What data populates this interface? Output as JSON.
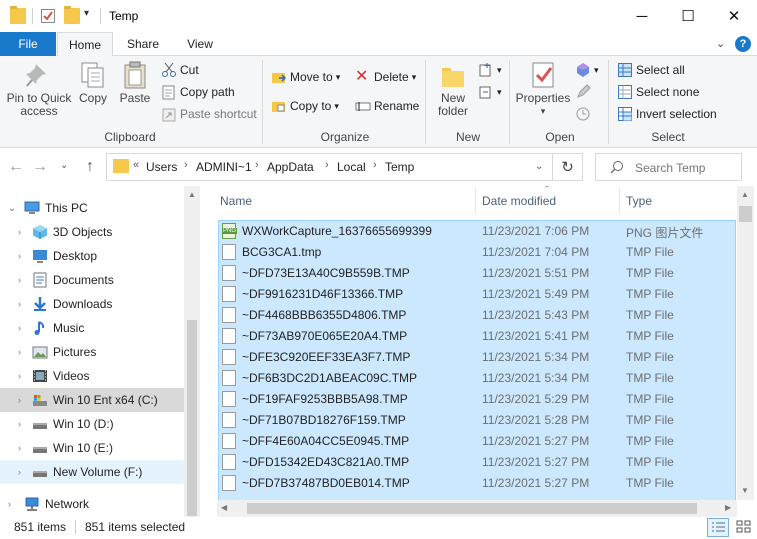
{
  "window": {
    "title": "Temp",
    "minimize_glyph": "─",
    "maximize_glyph": "☐",
    "close_glyph": "✕"
  },
  "ribbon_tabs": {
    "file": "File",
    "home": "Home",
    "share": "Share",
    "view": "View"
  },
  "ribbon": {
    "clipboard": {
      "label": "Clipboard",
      "pin": "Pin to Quick access",
      "copy": "Copy",
      "paste": "Paste",
      "cut": "Cut",
      "copy_path": "Copy path",
      "paste_shortcut": "Paste shortcut"
    },
    "organize": {
      "label": "Organize",
      "move_to": "Move to",
      "copy_to": "Copy to",
      "delete": "Delete",
      "rename": "Rename"
    },
    "new": {
      "label": "New",
      "new_folder": "New folder"
    },
    "open": {
      "label": "Open",
      "properties": "Properties"
    },
    "select": {
      "label": "Select",
      "select_all": "Select all",
      "select_none": "Select none",
      "invert_selection": "Invert selection"
    }
  },
  "address": {
    "overflow": "«",
    "crumbs": [
      "Users",
      "ADMINI~1",
      "AppData",
      "Local",
      "Temp"
    ],
    "search_placeholder": "Search Temp"
  },
  "nav_pane": {
    "items": [
      {
        "label": "This PC",
        "icon": "computer-icon"
      },
      {
        "label": "3D Objects",
        "icon": "cube-icon"
      },
      {
        "label": "Desktop",
        "icon": "desktop-icon"
      },
      {
        "label": "Documents",
        "icon": "document-icon"
      },
      {
        "label": "Downloads",
        "icon": "download-icon"
      },
      {
        "label": "Music",
        "icon": "music-icon"
      },
      {
        "label": "Pictures",
        "icon": "pictures-icon"
      },
      {
        "label": "Videos",
        "icon": "videos-icon"
      },
      {
        "label": "Win 10 Ent x64 (C:)",
        "icon": "drive-icon"
      },
      {
        "label": "Win 10 (D:)",
        "icon": "drive-icon"
      },
      {
        "label": "Win 10 (E:)",
        "icon": "drive-icon"
      },
      {
        "label": "New Volume (F:)",
        "icon": "drive-icon"
      },
      {
        "label": "Network",
        "icon": "network-icon"
      }
    ]
  },
  "columns": {
    "name": "Name",
    "date": "Date modified",
    "type": "Type"
  },
  "files": [
    {
      "name": "WXWorkCapture_16376655699399",
      "date": "11/23/2021 7:06 PM",
      "type": "PNG 图片文件",
      "icon": "png"
    },
    {
      "name": "BCG3CA1.tmp",
      "date": "11/23/2021 7:04 PM",
      "type": "TMP File",
      "icon": "tmp"
    },
    {
      "name": "~DFD73E13A40C9B559B.TMP",
      "date": "11/23/2021 5:51 PM",
      "type": "TMP File",
      "icon": "tmp"
    },
    {
      "name": "~DF9916231D46F13366.TMP",
      "date": "11/23/2021 5:49 PM",
      "type": "TMP File",
      "icon": "tmp"
    },
    {
      "name": "~DF4468BBB6355D4806.TMP",
      "date": "11/23/2021 5:43 PM",
      "type": "TMP File",
      "icon": "tmp"
    },
    {
      "name": "~DF73AB970E065E20A4.TMP",
      "date": "11/23/2021 5:41 PM",
      "type": "TMP File",
      "icon": "tmp"
    },
    {
      "name": "~DFE3C920EEF33EA3F7.TMP",
      "date": "11/23/2021 5:34 PM",
      "type": "TMP File",
      "icon": "tmp"
    },
    {
      "name": "~DF6B3DC2D1ABEAC09C.TMP",
      "date": "11/23/2021 5:34 PM",
      "type": "TMP File",
      "icon": "tmp"
    },
    {
      "name": "~DF19FAF9253BBB5A98.TMP",
      "date": "11/23/2021 5:29 PM",
      "type": "TMP File",
      "icon": "tmp"
    },
    {
      "name": "~DF71B07BD18276F159.TMP",
      "date": "11/23/2021 5:28 PM",
      "type": "TMP File",
      "icon": "tmp"
    },
    {
      "name": "~DFF4E60A04CC5E0945.TMP",
      "date": "11/23/2021 5:27 PM",
      "type": "TMP File",
      "icon": "tmp"
    },
    {
      "name": "~DFD15342ED43C821A0.TMP",
      "date": "11/23/2021 5:27 PM",
      "type": "TMP File",
      "icon": "tmp"
    },
    {
      "name": "~DFD7B37487BD0EB014.TMP",
      "date": "11/23/2021 5:27 PM",
      "type": "TMP File",
      "icon": "tmp"
    }
  ],
  "status": {
    "item_count": "851 items",
    "selected_count": "851 items selected"
  },
  "colors": {
    "accent": "#1979ca",
    "selection": "#cce8ff",
    "selection_border": "#99d1ff"
  }
}
